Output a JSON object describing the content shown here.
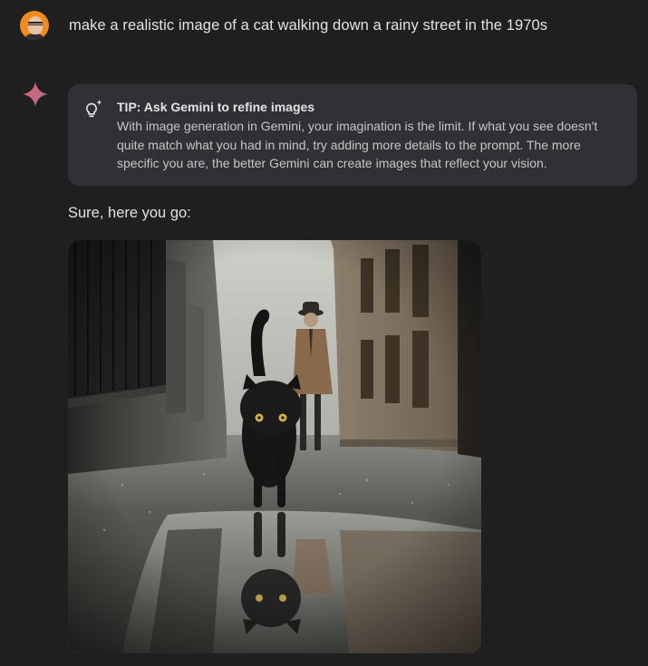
{
  "user_message": {
    "avatar_icon": "user-avatar",
    "text": "make a realistic image of a cat walking down a rainy street in the 1970s"
  },
  "response": {
    "assistant_icon": "gemini-sparkle-icon",
    "tip": {
      "icon": "lightbulb-sparkle-icon",
      "title": "TIP: Ask Gemini to refine images",
      "body": "With image generation in Gemini, your imagination is the limit. If what you see doesn't quite match what you had in mind, try adding more details to the prompt. The more specific you are, the better Gemini can create images that reflect your vision."
    },
    "text": "Sure, here you go:"
  },
  "colors": {
    "background": "#1f1f1f",
    "card": "#303134",
    "text_primary": "#e3e3e3",
    "text_secondary": "#c4c7c5",
    "avatar": "#f28b1f"
  }
}
